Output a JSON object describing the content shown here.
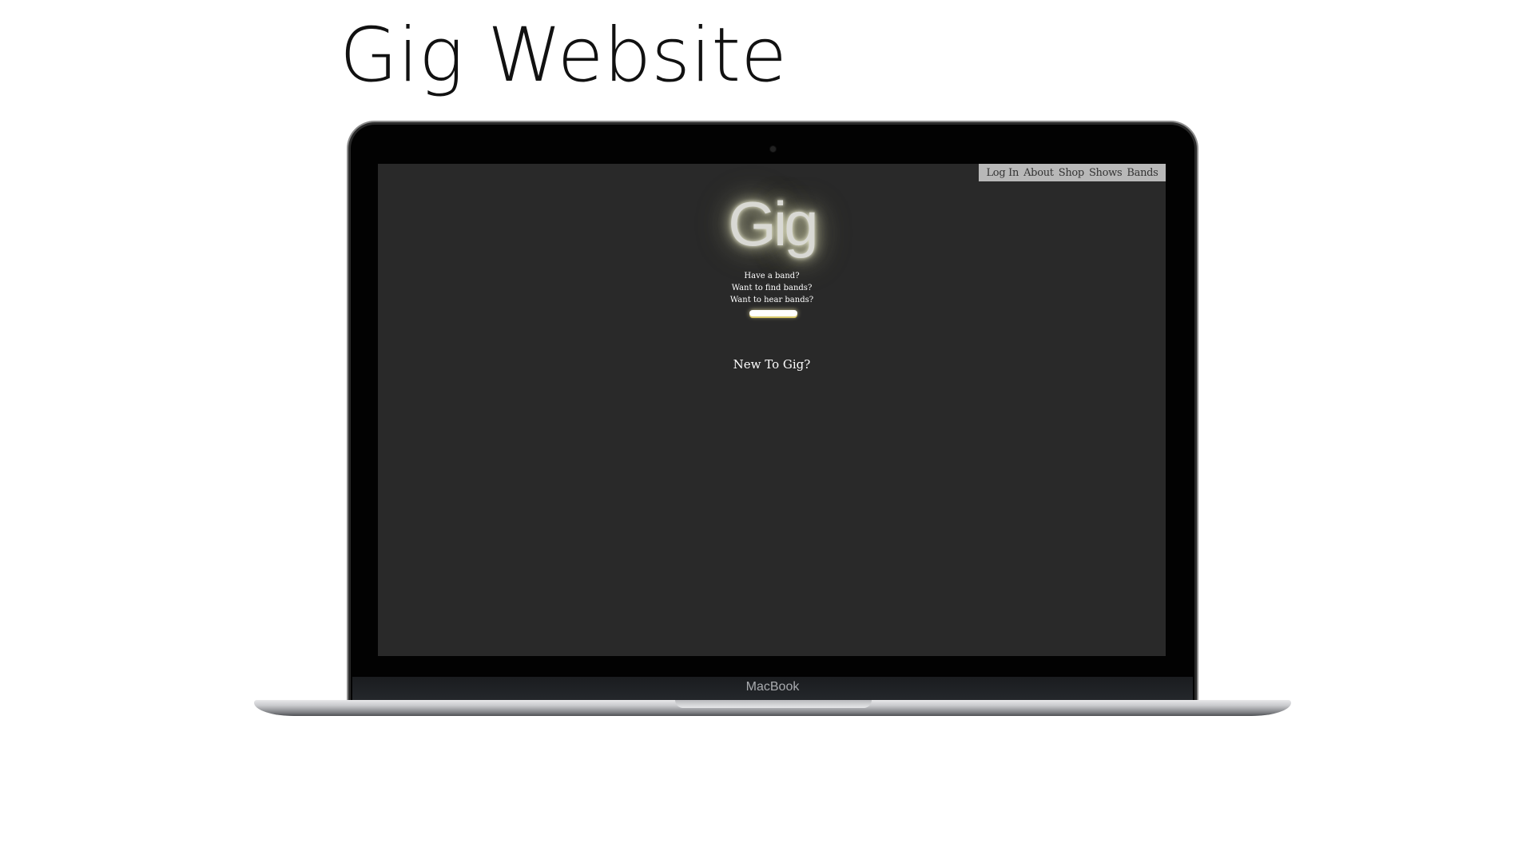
{
  "slide": {
    "title": "Gig Website"
  },
  "laptop": {
    "brand": "MacBook"
  },
  "site": {
    "nav": [
      "Log In",
      "About",
      "Shop",
      "Shows",
      "Bands"
    ],
    "logo": "Gig",
    "taglines": [
      "Have a band?",
      "Want to find bands?",
      "Want to hear bands?"
    ],
    "new_link": "New To Gig?",
    "colors": {
      "background": "#292929",
      "nav_bar": "#b8b8b8",
      "glow": "#f0f0c8"
    }
  }
}
